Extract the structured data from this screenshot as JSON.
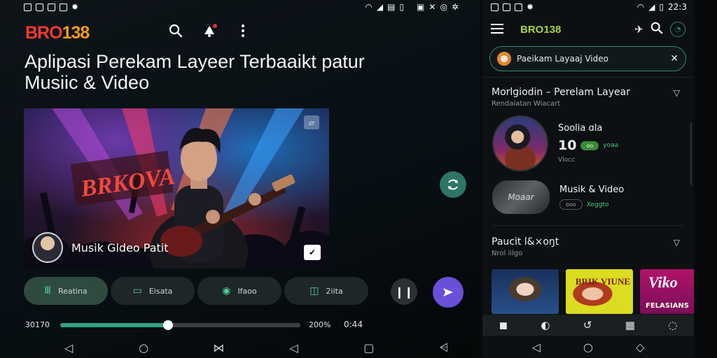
{
  "left": {
    "status_icons": [
      "gallery-icon",
      "download-icon",
      "image-icon",
      "photo-icon",
      "bug-icon"
    ],
    "status_right_icons": [
      "wifi-icon",
      "signal-icon",
      "sim-icon",
      "battery-icon",
      "nfc-icon",
      "mute-icon",
      "hotspot-icon",
      "settings-icon"
    ],
    "brand": {
      "text": "BRO",
      "num": "138"
    },
    "headline": "Aplipasi Perekam Layeer Terbaaikt patur Musiic & Video",
    "hero": {
      "sign": "BRKOVA",
      "caption": "Musik Gldeo Patit"
    },
    "chips": [
      {
        "icon": "equalizer-icon",
        "glyph": "Ⅲ",
        "label": "Reatina",
        "active": true
      },
      {
        "icon": "screen-icon",
        "glyph": "▭",
        "label": "Eisata",
        "active": false
      },
      {
        "icon": "stack-icon",
        "glyph": "◉",
        "label": "Ifaoo",
        "active": false
      },
      {
        "icon": "timer-icon",
        "glyph": "◫",
        "label": "2iita",
        "active": false
      }
    ],
    "time_start": "30170",
    "time_end": "200%",
    "time_total": "0:44",
    "progress": 0.45
  },
  "right": {
    "time": "22:3",
    "brand": "BRO138",
    "search": {
      "value": "Paeikam Layaaj Video"
    },
    "section1": {
      "title": "Morlgiodin – Perelam Layear",
      "sub": "Rendaiatan Wiacart"
    },
    "item1": {
      "name": "Soolia ɑla",
      "big": "10",
      "pill": "oo",
      "green": "yoaa",
      "small": "Vlocc"
    },
    "item2": {
      "name": "Musik & Video",
      "thumb": "Moaar",
      "pill": "ooo",
      "green": "Xeggto"
    },
    "section2": {
      "title": "Paucit l&×oŋt",
      "sub": "Nrol iilgo"
    },
    "cards": [
      {
        "text": ""
      },
      {
        "text": "BRIK VIUNE"
      },
      {
        "text": "Viko",
        "sub": "FELASIANS"
      }
    ]
  }
}
